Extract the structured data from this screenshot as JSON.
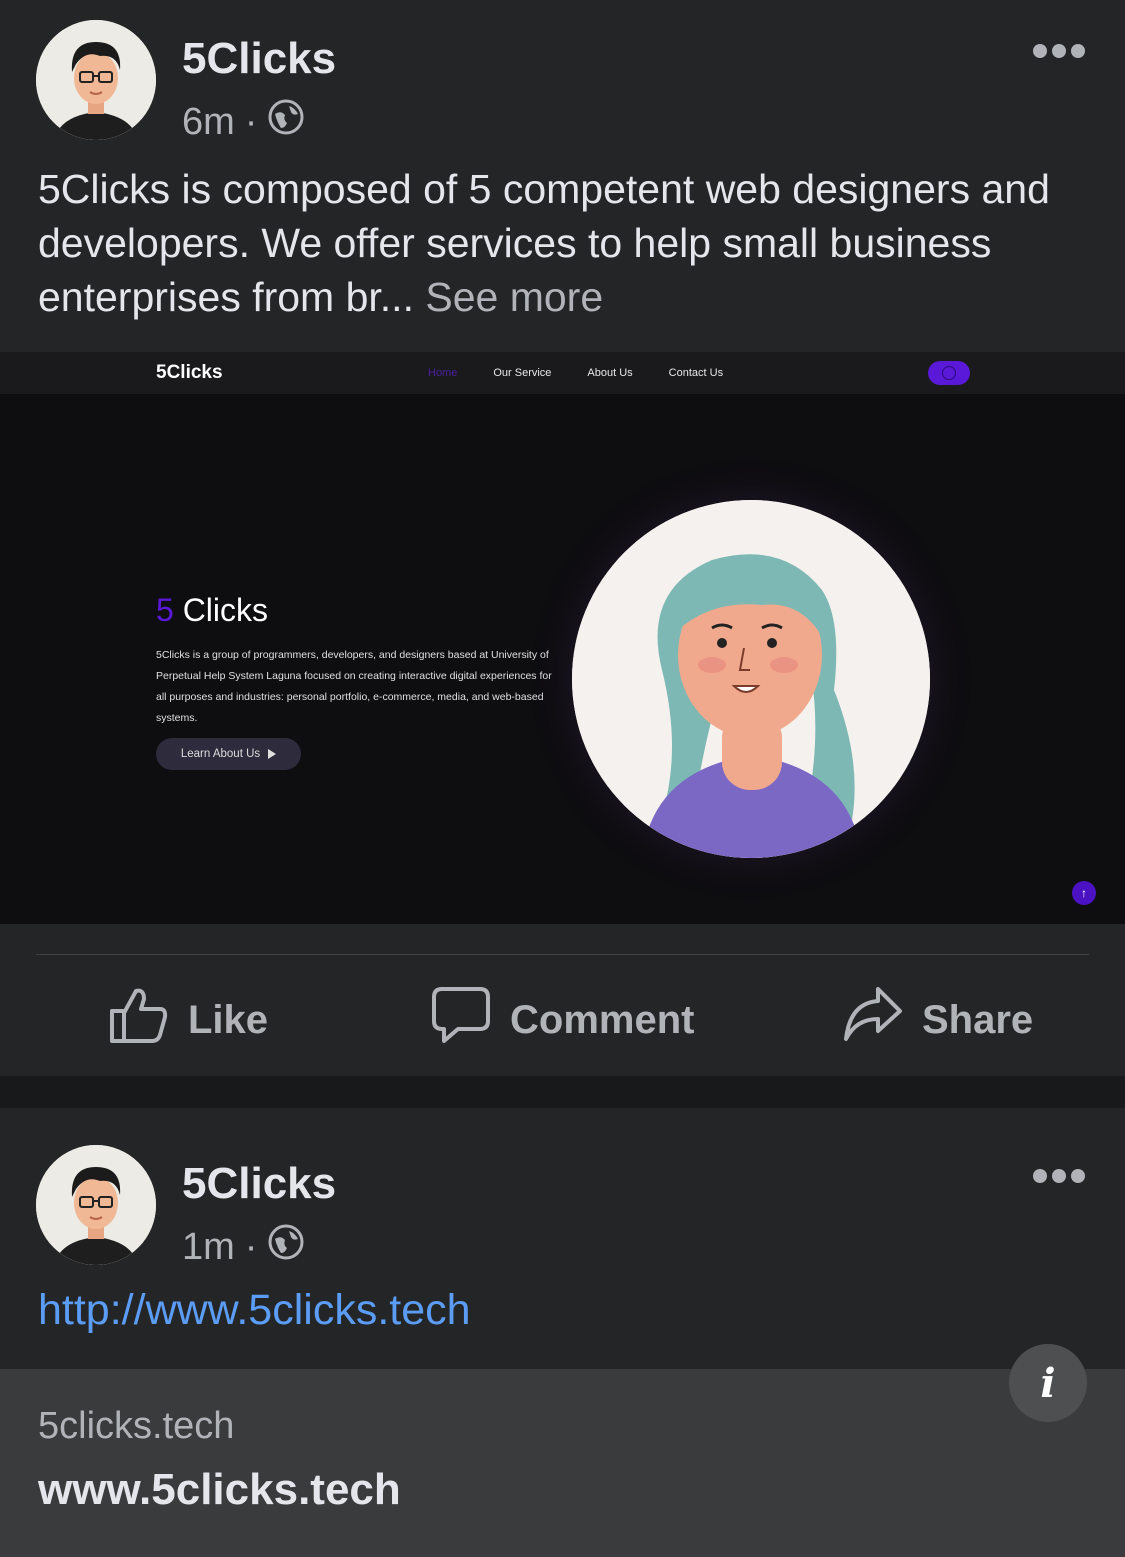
{
  "posts": [
    {
      "author": "5Clicks",
      "time": "6m",
      "separator": "·",
      "text": "5Clicks is composed of 5 competent web designers and developers. We offer services to help small business enterprises from br...",
      "see_more": "See more",
      "preview": {
        "logo": "5Clicks",
        "nav": [
          "Home",
          "Our Service",
          "About Us",
          "Contact Us"
        ],
        "hero_title_num": "5",
        "hero_title_text": "Clicks",
        "hero_desc": "5Clicks is a group of programmers, developers, and designers based at University of Perpetual Help System Laguna focused on creating interactive digital experiences for all purposes and industries: personal portfolio, e-commerce, media, and web-based systems.",
        "button": "Learn About Us",
        "back_to_top": "↑"
      },
      "actions": {
        "like": "Like",
        "comment": "Comment",
        "share": "Share"
      }
    },
    {
      "author": "5Clicks",
      "time": "1m",
      "separator": "·",
      "link": "http://www.5clicks.tech",
      "card_domain": "5clicks.tech",
      "card_title": "www.5clicks.tech",
      "info": "i"
    }
  ],
  "colors": {
    "background": "#18191a",
    "card": "#242526",
    "link": "#5b9cf4",
    "accent_purple": "#5a18d8"
  },
  "icons": [
    "globe-icon",
    "more-dots-icon",
    "like-icon",
    "comment-icon",
    "share-icon",
    "info-icon"
  ]
}
